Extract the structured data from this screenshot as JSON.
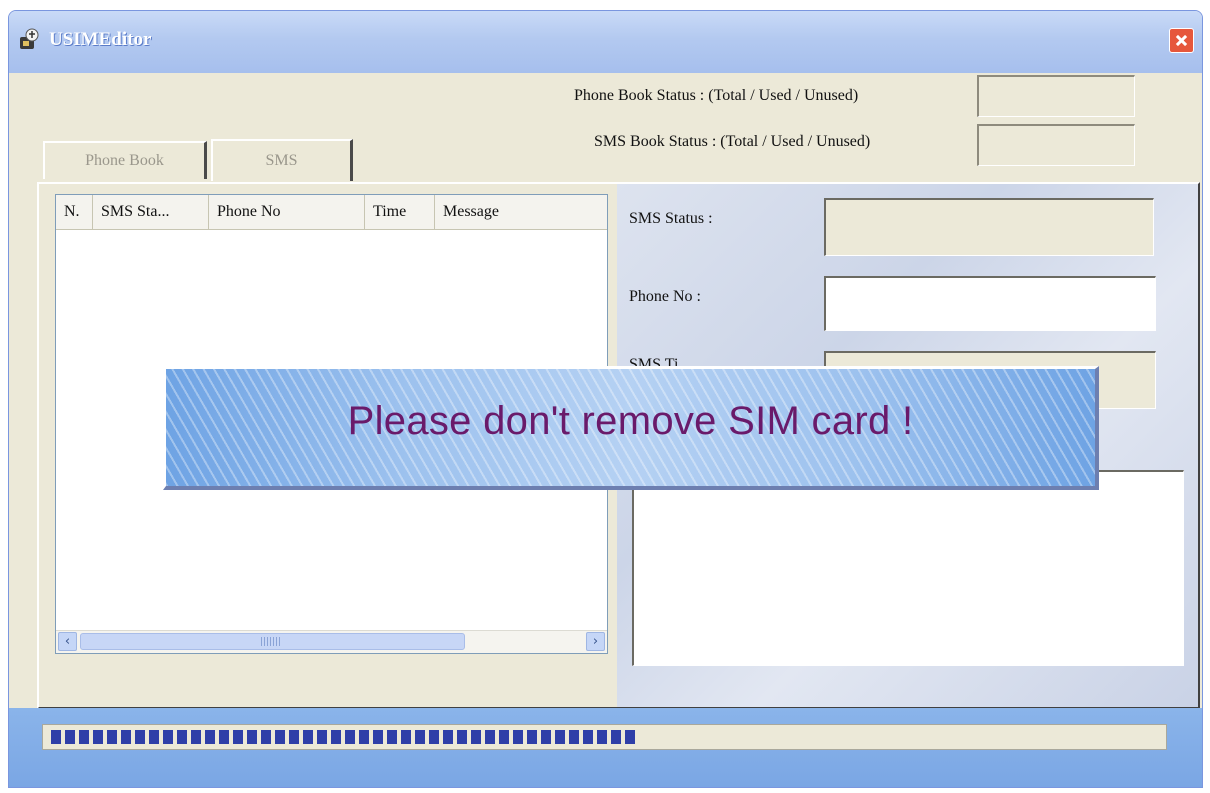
{
  "window": {
    "title": "USIMEditor"
  },
  "status": {
    "phone_book_label": "Phone Book Status : (Total / Used / Unused)",
    "sms_book_label": "SMS Book Status : (Total / Used / Unused)",
    "phone_book_value": "",
    "sms_book_value": ""
  },
  "tabs": [
    {
      "label": "Phone Book",
      "state": "disabled"
    },
    {
      "label": "SMS",
      "state": "selected-disabled"
    }
  ],
  "sms_list": {
    "columns": [
      "N.",
      "SMS Sta...",
      "Phone No",
      "Time",
      "Message"
    ],
    "rows": []
  },
  "details": {
    "sms_status_label": "SMS Status :",
    "phone_no_label": "Phone No :",
    "sms_time_label_visible": "SMS Ti",
    "sms_status_value": "",
    "phone_no_value": "",
    "sms_time_value": "",
    "message_value": ""
  },
  "overlay": {
    "message": "Please don't remove SIM card  !"
  },
  "progress": {
    "percent": 53
  },
  "colors": {
    "banner_text": "#6a1a6a",
    "progress_fill": "#2e3fa8",
    "title_bar": "#b3c9f0"
  }
}
